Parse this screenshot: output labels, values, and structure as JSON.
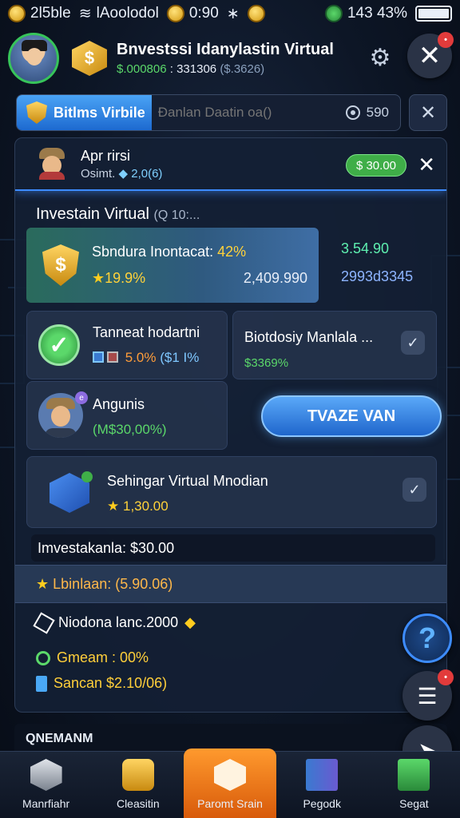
{
  "status_bar": {
    "left_text": "2l5ble",
    "network": "lAoolodol",
    "time": "0:90",
    "signal": "143 43%"
  },
  "header": {
    "logo_letter": "$",
    "title": "Bnvestssi Idanylastin Virtual",
    "balance_green": "$.000806",
    "balance_white": ": 331306",
    "balance_dim": "($.3626)",
    "close_badge": "•"
  },
  "search": {
    "tab_label": "Bitlms Virbile",
    "placeholder": "Ðanlan Daatin oa()",
    "count": "590"
  },
  "user": {
    "name": "Apr rirsi",
    "sub_label": "Osimt.",
    "sub_value": "2,0(6)",
    "pill": "$ 30.00"
  },
  "section": {
    "title": "Investain Virtual",
    "suffix": "(Q 10:..."
  },
  "feature": {
    "title": "Sbndura Inontacat:",
    "title_pct": "42%",
    "rate": "19.9%",
    "amount": "2,409.990",
    "side_top": "3.54.90",
    "side_bottom": "2993d3345"
  },
  "cards": {
    "c1_title": "Tanneat hodartni",
    "c1_pct": "5.0%",
    "c1_extra": "($1 I%",
    "c2_title": "Biotdosiy Manlala ...",
    "c2_sub": "$3369%",
    "c3_title": "Angunis",
    "c3_sub": "(M$30,00%)",
    "c3_badge": "e",
    "cta": "TVAZE VAN",
    "c5_title": "Sehingar Virtual Mnodian",
    "c5_value": "1,30.00"
  },
  "summary": {
    "bar": "Imvestakanla: $30.00",
    "strip": "Lbinlaan: (5.90.06)"
  },
  "info": {
    "line1": "Niodona lanc.2000",
    "line2": "Gmeam : 00%",
    "line3": "Sancan $2.10/06)"
  },
  "bottom_label": "QNEMANM",
  "fabs": {
    "help": "?",
    "list_badge": "•"
  },
  "nav": [
    {
      "label": "Manrfiahr",
      "icon": "box-icon"
    },
    {
      "label": "Cleasitin",
      "icon": "coin-chest-icon"
    },
    {
      "label": "Paromt Srain",
      "icon": "home-icon"
    },
    {
      "label": "Pegodk",
      "icon": "books-icon"
    },
    {
      "label": "Segat",
      "icon": "cash-icon"
    }
  ]
}
